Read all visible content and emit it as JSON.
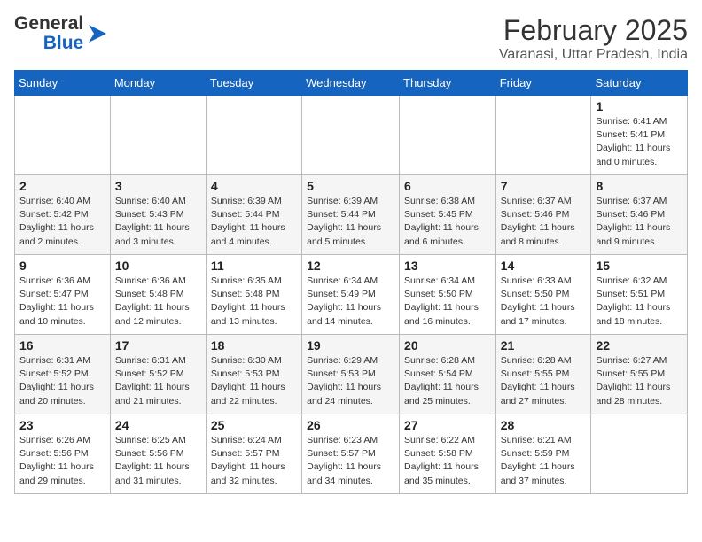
{
  "header": {
    "logo_general": "General",
    "logo_blue": "Blue",
    "month": "February 2025",
    "location": "Varanasi, Uttar Pradesh, India"
  },
  "days_of_week": [
    "Sunday",
    "Monday",
    "Tuesday",
    "Wednesday",
    "Thursday",
    "Friday",
    "Saturday"
  ],
  "weeks": [
    [
      {
        "day": "",
        "info": ""
      },
      {
        "day": "",
        "info": ""
      },
      {
        "day": "",
        "info": ""
      },
      {
        "day": "",
        "info": ""
      },
      {
        "day": "",
        "info": ""
      },
      {
        "day": "",
        "info": ""
      },
      {
        "day": "1",
        "info": "Sunrise: 6:41 AM\nSunset: 5:41 PM\nDaylight: 11 hours\nand 0 minutes."
      }
    ],
    [
      {
        "day": "2",
        "info": "Sunrise: 6:40 AM\nSunset: 5:42 PM\nDaylight: 11 hours\nand 2 minutes."
      },
      {
        "day": "3",
        "info": "Sunrise: 6:40 AM\nSunset: 5:43 PM\nDaylight: 11 hours\nand 3 minutes."
      },
      {
        "day": "4",
        "info": "Sunrise: 6:39 AM\nSunset: 5:44 PM\nDaylight: 11 hours\nand 4 minutes."
      },
      {
        "day": "5",
        "info": "Sunrise: 6:39 AM\nSunset: 5:44 PM\nDaylight: 11 hours\nand 5 minutes."
      },
      {
        "day": "6",
        "info": "Sunrise: 6:38 AM\nSunset: 5:45 PM\nDaylight: 11 hours\nand 6 minutes."
      },
      {
        "day": "7",
        "info": "Sunrise: 6:37 AM\nSunset: 5:46 PM\nDaylight: 11 hours\nand 8 minutes."
      },
      {
        "day": "8",
        "info": "Sunrise: 6:37 AM\nSunset: 5:46 PM\nDaylight: 11 hours\nand 9 minutes."
      }
    ],
    [
      {
        "day": "9",
        "info": "Sunrise: 6:36 AM\nSunset: 5:47 PM\nDaylight: 11 hours\nand 10 minutes."
      },
      {
        "day": "10",
        "info": "Sunrise: 6:36 AM\nSunset: 5:48 PM\nDaylight: 11 hours\nand 12 minutes."
      },
      {
        "day": "11",
        "info": "Sunrise: 6:35 AM\nSunset: 5:48 PM\nDaylight: 11 hours\nand 13 minutes."
      },
      {
        "day": "12",
        "info": "Sunrise: 6:34 AM\nSunset: 5:49 PM\nDaylight: 11 hours\nand 14 minutes."
      },
      {
        "day": "13",
        "info": "Sunrise: 6:34 AM\nSunset: 5:50 PM\nDaylight: 11 hours\nand 16 minutes."
      },
      {
        "day": "14",
        "info": "Sunrise: 6:33 AM\nSunset: 5:50 PM\nDaylight: 11 hours\nand 17 minutes."
      },
      {
        "day": "15",
        "info": "Sunrise: 6:32 AM\nSunset: 5:51 PM\nDaylight: 11 hours\nand 18 minutes."
      }
    ],
    [
      {
        "day": "16",
        "info": "Sunrise: 6:31 AM\nSunset: 5:52 PM\nDaylight: 11 hours\nand 20 minutes."
      },
      {
        "day": "17",
        "info": "Sunrise: 6:31 AM\nSunset: 5:52 PM\nDaylight: 11 hours\nand 21 minutes."
      },
      {
        "day": "18",
        "info": "Sunrise: 6:30 AM\nSunset: 5:53 PM\nDaylight: 11 hours\nand 22 minutes."
      },
      {
        "day": "19",
        "info": "Sunrise: 6:29 AM\nSunset: 5:53 PM\nDaylight: 11 hours\nand 24 minutes."
      },
      {
        "day": "20",
        "info": "Sunrise: 6:28 AM\nSunset: 5:54 PM\nDaylight: 11 hours\nand 25 minutes."
      },
      {
        "day": "21",
        "info": "Sunrise: 6:28 AM\nSunset: 5:55 PM\nDaylight: 11 hours\nand 27 minutes."
      },
      {
        "day": "22",
        "info": "Sunrise: 6:27 AM\nSunset: 5:55 PM\nDaylight: 11 hours\nand 28 minutes."
      }
    ],
    [
      {
        "day": "23",
        "info": "Sunrise: 6:26 AM\nSunset: 5:56 PM\nDaylight: 11 hours\nand 29 minutes."
      },
      {
        "day": "24",
        "info": "Sunrise: 6:25 AM\nSunset: 5:56 PM\nDaylight: 11 hours\nand 31 minutes."
      },
      {
        "day": "25",
        "info": "Sunrise: 6:24 AM\nSunset: 5:57 PM\nDaylight: 11 hours\nand 32 minutes."
      },
      {
        "day": "26",
        "info": "Sunrise: 6:23 AM\nSunset: 5:57 PM\nDaylight: 11 hours\nand 34 minutes."
      },
      {
        "day": "27",
        "info": "Sunrise: 6:22 AM\nSunset: 5:58 PM\nDaylight: 11 hours\nand 35 minutes."
      },
      {
        "day": "28",
        "info": "Sunrise: 6:21 AM\nSunset: 5:59 PM\nDaylight: 11 hours\nand 37 minutes."
      },
      {
        "day": "",
        "info": ""
      }
    ]
  ]
}
